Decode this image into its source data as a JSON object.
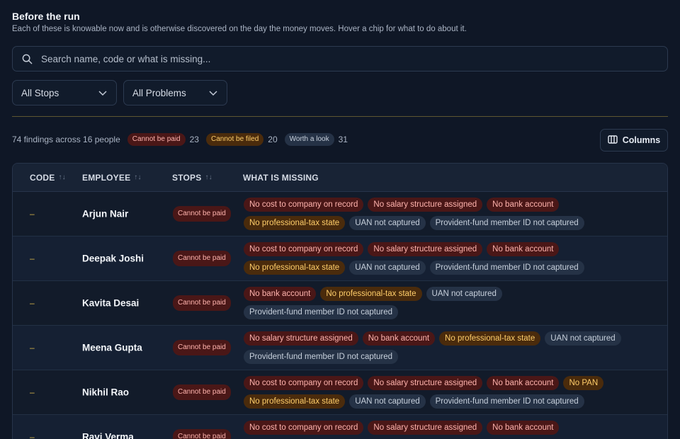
{
  "header": {
    "title": "Before the run",
    "subtitle": "Each of these is knowable now and is otherwise discovered on the day the money moves. Hover a chip for what to do about it."
  },
  "search": {
    "placeholder": "Search name, code or what is missing..."
  },
  "filters": {
    "stops": "All Stops",
    "problems": "All Problems"
  },
  "summary": {
    "text": "74 findings across 16 people",
    "badges": [
      {
        "label": "Cannot be paid",
        "count": "23",
        "tone": "red"
      },
      {
        "label": "Cannot be filed",
        "count": "20",
        "tone": "amber"
      },
      {
        "label": "Worth a look",
        "count": "31",
        "tone": "grey"
      }
    ]
  },
  "toolbar": {
    "columns_label": "Columns"
  },
  "table": {
    "headers": {
      "code": "CODE",
      "employee": "EMPLOYEE",
      "stops": "STOPS",
      "missing": "WHAT IS MISSING"
    },
    "rows": [
      {
        "code": "–",
        "employee": "Arjun Nair",
        "stop": "Cannot be paid",
        "missing": [
          {
            "text": "No cost to company on record",
            "tone": "red"
          },
          {
            "text": "No salary structure assigned",
            "tone": "red"
          },
          {
            "text": "No bank account",
            "tone": "red"
          },
          {
            "text": "No professional-tax state",
            "tone": "amber"
          },
          {
            "text": "UAN not captured",
            "tone": "grey"
          },
          {
            "text": "Provident-fund member ID not captured",
            "tone": "grey"
          }
        ]
      },
      {
        "code": "–",
        "employee": "Deepak Joshi",
        "stop": "Cannot be paid",
        "missing": [
          {
            "text": "No cost to company on record",
            "tone": "red"
          },
          {
            "text": "No salary structure assigned",
            "tone": "red"
          },
          {
            "text": "No bank account",
            "tone": "red"
          },
          {
            "text": "No professional-tax state",
            "tone": "amber"
          },
          {
            "text": "UAN not captured",
            "tone": "grey"
          },
          {
            "text": "Provident-fund member ID not captured",
            "tone": "grey"
          }
        ]
      },
      {
        "code": "–",
        "employee": "Kavita Desai",
        "stop": "Cannot be paid",
        "missing": [
          {
            "text": "No bank account",
            "tone": "red"
          },
          {
            "text": "No professional-tax state",
            "tone": "amber"
          },
          {
            "text": "UAN not captured",
            "tone": "grey"
          },
          {
            "text": "Provident-fund member ID not captured",
            "tone": "grey"
          }
        ]
      },
      {
        "code": "–",
        "employee": "Meena Gupta",
        "stop": "Cannot be paid",
        "missing": [
          {
            "text": "No salary structure assigned",
            "tone": "red"
          },
          {
            "text": "No bank account",
            "tone": "red"
          },
          {
            "text": "No professional-tax state",
            "tone": "amber"
          },
          {
            "text": "UAN not captured",
            "tone": "grey"
          },
          {
            "text": "Provident-fund member ID not captured",
            "tone": "grey"
          }
        ]
      },
      {
        "code": "–",
        "employee": "Nikhil Rao",
        "stop": "Cannot be paid",
        "missing": [
          {
            "text": "No cost to company on record",
            "tone": "red"
          },
          {
            "text": "No salary structure assigned",
            "tone": "red"
          },
          {
            "text": "No bank account",
            "tone": "red"
          },
          {
            "text": "No PAN",
            "tone": "amber"
          },
          {
            "text": "No professional-tax state",
            "tone": "amber"
          },
          {
            "text": "UAN not captured",
            "tone": "grey"
          },
          {
            "text": "Provident-fund member ID not captured",
            "tone": "grey"
          }
        ]
      },
      {
        "code": "–",
        "employee": "Ravi Verma",
        "stop": "Cannot be paid",
        "missing": [
          {
            "text": "No cost to company on record",
            "tone": "red"
          },
          {
            "text": "No salary structure assigned",
            "tone": "red"
          },
          {
            "text": "No bank account",
            "tone": "red"
          }
        ]
      }
    ]
  },
  "colors": {
    "background": "#0f1726",
    "danger": "#ffb3ad",
    "warning": "#ffce6a",
    "divider": "#5e5631"
  },
  "icons": {
    "search": "search-icon",
    "chevron": "chevron-down-icon",
    "columns": "columns-icon",
    "sort": "sort-icon"
  }
}
